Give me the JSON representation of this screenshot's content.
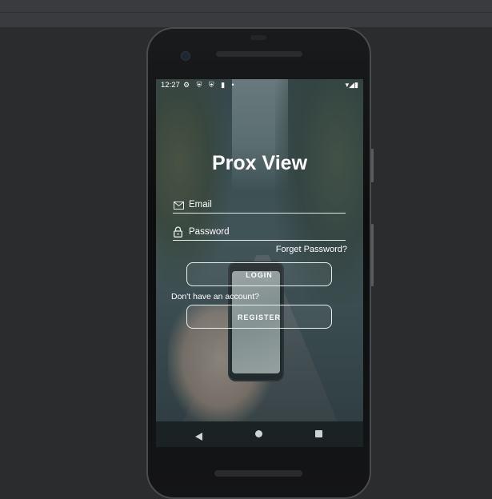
{
  "status_bar": {
    "time": "12:27",
    "left_icons": "⚙ ⛨ ⛨ ▮ •",
    "right_icons": "▾◢▮"
  },
  "app": {
    "title": "Prox View"
  },
  "form": {
    "email_placeholder": "Email",
    "password_placeholder": "Password",
    "forgot_password": "Forget Password?",
    "login_label": "LOGIN",
    "no_account_text": "Don't have an account?",
    "register_label": "REGISTER"
  },
  "icons": {
    "email": "mail-icon",
    "password": "lock-icon",
    "nav_back": "back-icon",
    "nav_home": "home-icon",
    "nav_recents": "recents-icon"
  },
  "colors": {
    "text": "#ffffff",
    "page_background": "#2b2c2e",
    "nav_bar": "#1a2224"
  }
}
